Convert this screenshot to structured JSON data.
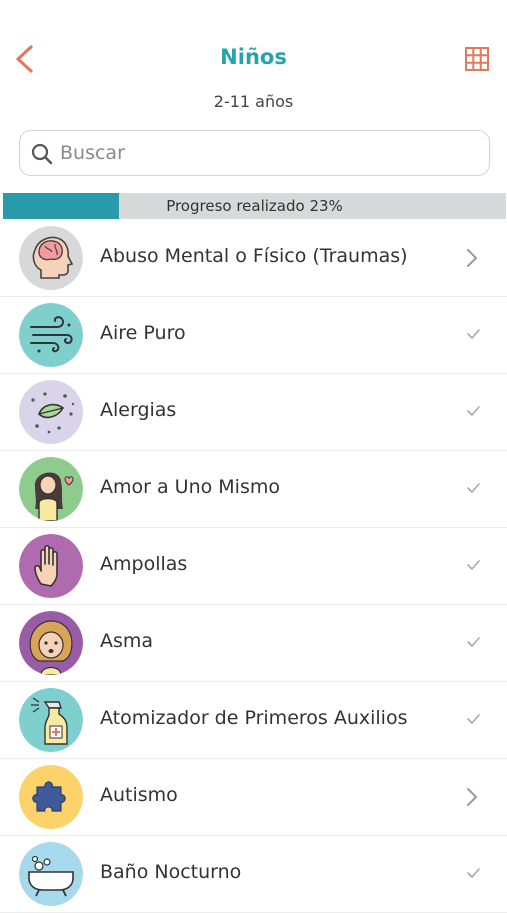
{
  "header": {
    "title": "Niños",
    "subtitle": "2-11 años",
    "accent_color": "#25A3AB",
    "icon_color": "#E07A5F",
    "back_icon": "chevron-left-icon",
    "grid_icon": "grid-icon"
  },
  "search": {
    "placeholder": "Buscar",
    "value": ""
  },
  "progress": {
    "label": "Progreso realizado 23%",
    "fraction": 0.23,
    "fill_color": "#2A9BAA"
  },
  "items": [
    {
      "label": "Abuso Mental o Físico (Traumas)",
      "status": "chevron",
      "icon": "brain-head-icon",
      "color": "#D8D8D8"
    },
    {
      "label": "Aire Puro",
      "status": "check",
      "icon": "wind-icon",
      "color": "#7FCFCF"
    },
    {
      "label": "Alergias",
      "status": "check",
      "icon": "leaf-pollen-icon",
      "color": "#D9D4EA"
    },
    {
      "label": "Amor a Uno Mismo",
      "status": "check",
      "icon": "girl-heart-icon",
      "color": "#8FCB8C"
    },
    {
      "label": "Ampollas",
      "status": "check",
      "icon": "hand-icon",
      "color": "#B06AAE"
    },
    {
      "label": "Asma",
      "status": "check",
      "icon": "girl-face-icon",
      "color": "#9A5CA6"
    },
    {
      "label": "Atomizador de Primeros Auxilios",
      "status": "check",
      "icon": "spray-bottle-icon",
      "color": "#7FCFCF"
    },
    {
      "label": "Autismo",
      "status": "chevron",
      "icon": "puzzle-piece-icon",
      "color": "#FCD36A"
    },
    {
      "label": "Baño Nocturno",
      "status": "check",
      "icon": "bathtub-icon",
      "color": "#A6D9EC"
    }
  ]
}
